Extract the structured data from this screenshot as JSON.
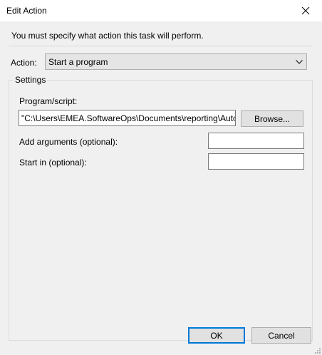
{
  "window": {
    "title": "Edit Action",
    "close_icon": "close-icon"
  },
  "instruction": "You must specify what action this task will perform.",
  "action": {
    "label": "Action:",
    "selected": "Start a program",
    "arrow_icon": "chevron-down-icon"
  },
  "settings": {
    "group_label": "Settings",
    "program_label": "Program/script:",
    "program_value": "\"C:\\Users\\EMEA.SoftwareOps\\Documents\\reporting\\Auto",
    "browse_label": "Browse...",
    "args_label": "Add arguments (optional):",
    "args_value": "",
    "start_label": "Start in (optional):",
    "start_value": ""
  },
  "buttons": {
    "ok": "OK",
    "cancel": "Cancel"
  }
}
